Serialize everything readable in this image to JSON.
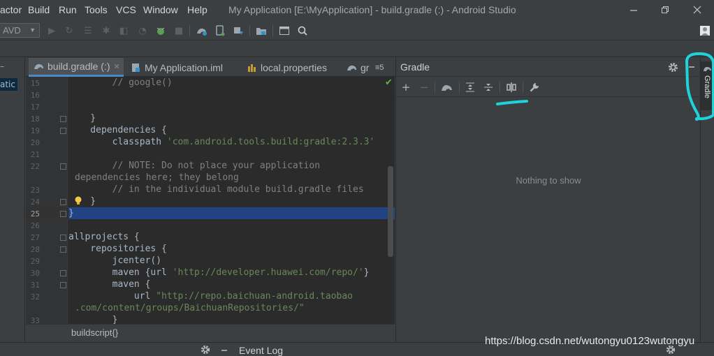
{
  "menubar": {
    "items": [
      "actor",
      "Build",
      "Run",
      "Tools",
      "VCS",
      "Window",
      "Help"
    ],
    "window_title": "My Application [E:\\MyApplication] - build.gradle (:) - Android Studio"
  },
  "toolbar": {
    "avd_label": "AVD"
  },
  "project_panel": {
    "selected_fragment": "atic"
  },
  "editor": {
    "tabs": [
      {
        "label": "build.gradle (:)",
        "active": true
      },
      {
        "label": "My Application.iml",
        "active": false
      },
      {
        "label": "local.properties",
        "active": false
      },
      {
        "label": "gr",
        "active": false
      }
    ],
    "tab_overflow": "≡5",
    "line_numbers": [
      "15",
      "16",
      "17",
      "18",
      "19",
      "20",
      "21",
      "22",
      "",
      "23",
      "24",
      "25",
      "26",
      "27",
      "28",
      "29",
      "30",
      "31",
      "32",
      "",
      "33"
    ],
    "code_lines": [
      {
        "text": "        // google()",
        "kind": "comment"
      },
      {
        "text": "",
        "kind": "plain"
      },
      {
        "text": "",
        "kind": "plain"
      },
      {
        "text": "    }",
        "kind": "plain"
      },
      {
        "text": "    dependencies {",
        "kind": "plain"
      },
      {
        "text": "        classpath ",
        "kind": "plain",
        "str": "'com.android.tools.build:gradle:2.3.3'"
      },
      {
        "text": "",
        "kind": "plain"
      },
      {
        "text": "        // NOTE: Do not place your application",
        "kind": "comment"
      },
      {
        "text": "dependencies here; they belong",
        "kind": "comment"
      },
      {
        "text": "        // in the individual module build.gradle files",
        "kind": "comment"
      },
      {
        "text": "    }",
        "kind": "plain"
      },
      {
        "text": "}",
        "kind": "plain"
      },
      {
        "text": "",
        "kind": "plain"
      },
      {
        "text": "allprojects {",
        "kind": "plain"
      },
      {
        "text": "    repositories {",
        "kind": "plain"
      },
      {
        "text": "        jcenter()",
        "kind": "plain"
      },
      {
        "text": "        maven {url ",
        "kind": "plain",
        "str": "'http://developer.huawei.com/repo/'",
        "tail": "}"
      },
      {
        "text": "        maven {",
        "kind": "plain"
      },
      {
        "text": "            url ",
        "kind": "plain",
        "str": "\"http://repo.baichuan-android.taobao"
      },
      {
        "text": "",
        "kind": "plain",
        "str": ".com/content/groups/BaichuanRepositories/\""
      },
      {
        "text": "        }",
        "kind": "plain"
      }
    ],
    "breadcrumb": "buildscript{}"
  },
  "gradle_panel": {
    "title": "Gradle",
    "empty_text": "Nothing to show",
    "strip_label": "Gradle"
  },
  "bottom": {
    "event_log": "Event Log"
  },
  "watermark": "https://blog.csdn.net/wutongyu0123wutongyu",
  "colors": {
    "accent": "#4a88c7",
    "selection": "#214283",
    "annotation": "#1ed3dc"
  }
}
